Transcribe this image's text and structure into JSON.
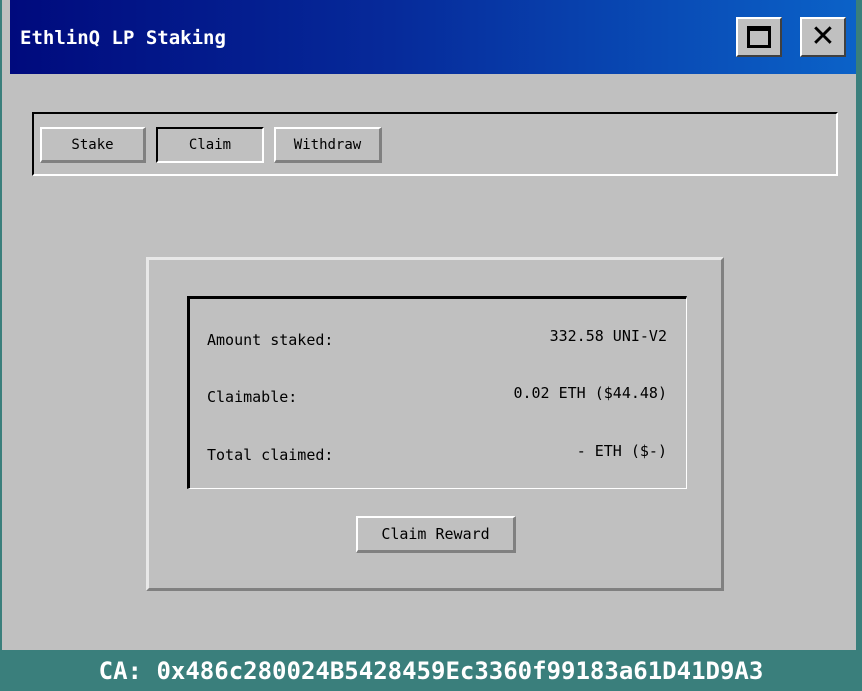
{
  "window": {
    "title": "EthlinQ LP Staking",
    "maximize_icon": "maximize-icon",
    "close_icon": "close-icon",
    "close_glyph": "✕"
  },
  "tabs": [
    {
      "label": "Stake",
      "active": false
    },
    {
      "label": "Claim",
      "active": true
    },
    {
      "label": "Withdraw",
      "active": false
    }
  ],
  "claim_panel": {
    "rows": [
      {
        "label": "Amount staked:",
        "value": "332.58 UNI-V2"
      },
      {
        "label": "Claimable:",
        "value": "0.02 ETH ($44.48)"
      },
      {
        "label": "Total claimed:",
        "value": "- ETH ($-)"
      }
    ],
    "button_label": "Claim Reward"
  },
  "footer": {
    "contract_address": "CA: 0x486c280024B5428459Ec3360f99183a61D41D9A3"
  },
  "colors": {
    "desktop": "#3a7f7c",
    "window_bg": "#c0c0c0",
    "titlebar_start": "#000a7d",
    "titlebar_end": "#0b62c8"
  }
}
